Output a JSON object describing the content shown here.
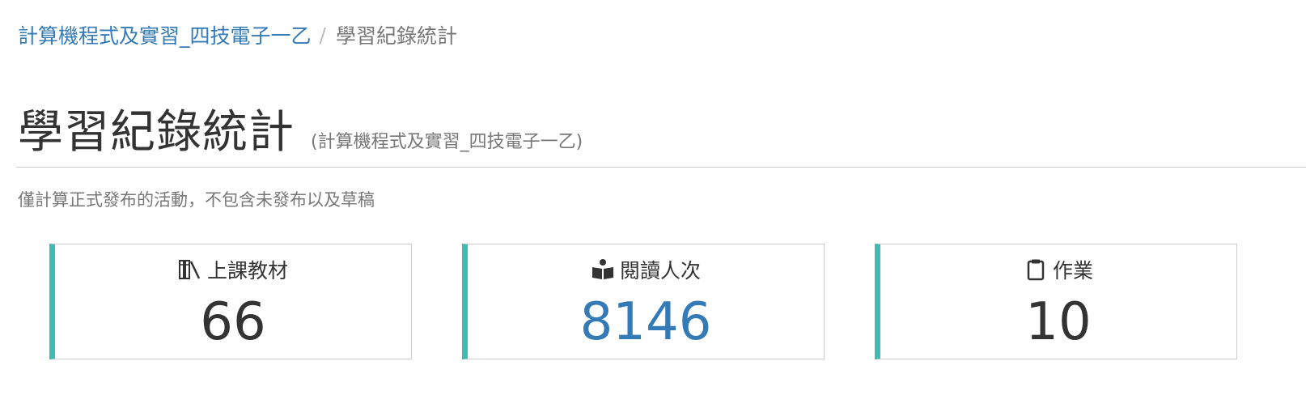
{
  "breadcrumb": {
    "course_link": "計算機程式及實習_四技電子一乙",
    "separator": "/",
    "current": "學習紀錄統計"
  },
  "header": {
    "title": "學習紀錄統計",
    "subtitle": "(計算機程式及實習_四技電子一乙)"
  },
  "note": "僅計算正式發布的活動，不包含未發布以及草稿",
  "cards": [
    {
      "icon": "books-icon",
      "label": "上課教材",
      "value": "66"
    },
    {
      "icon": "open-book-icon",
      "label": "閱讀人次",
      "value": "8146"
    },
    {
      "icon": "clipboard-icon",
      "label": "作業",
      "value": "10"
    }
  ],
  "colors": {
    "link": "#337ab7",
    "card_accent": "#3fbab8",
    "text": "#333333",
    "muted": "#777777"
  }
}
